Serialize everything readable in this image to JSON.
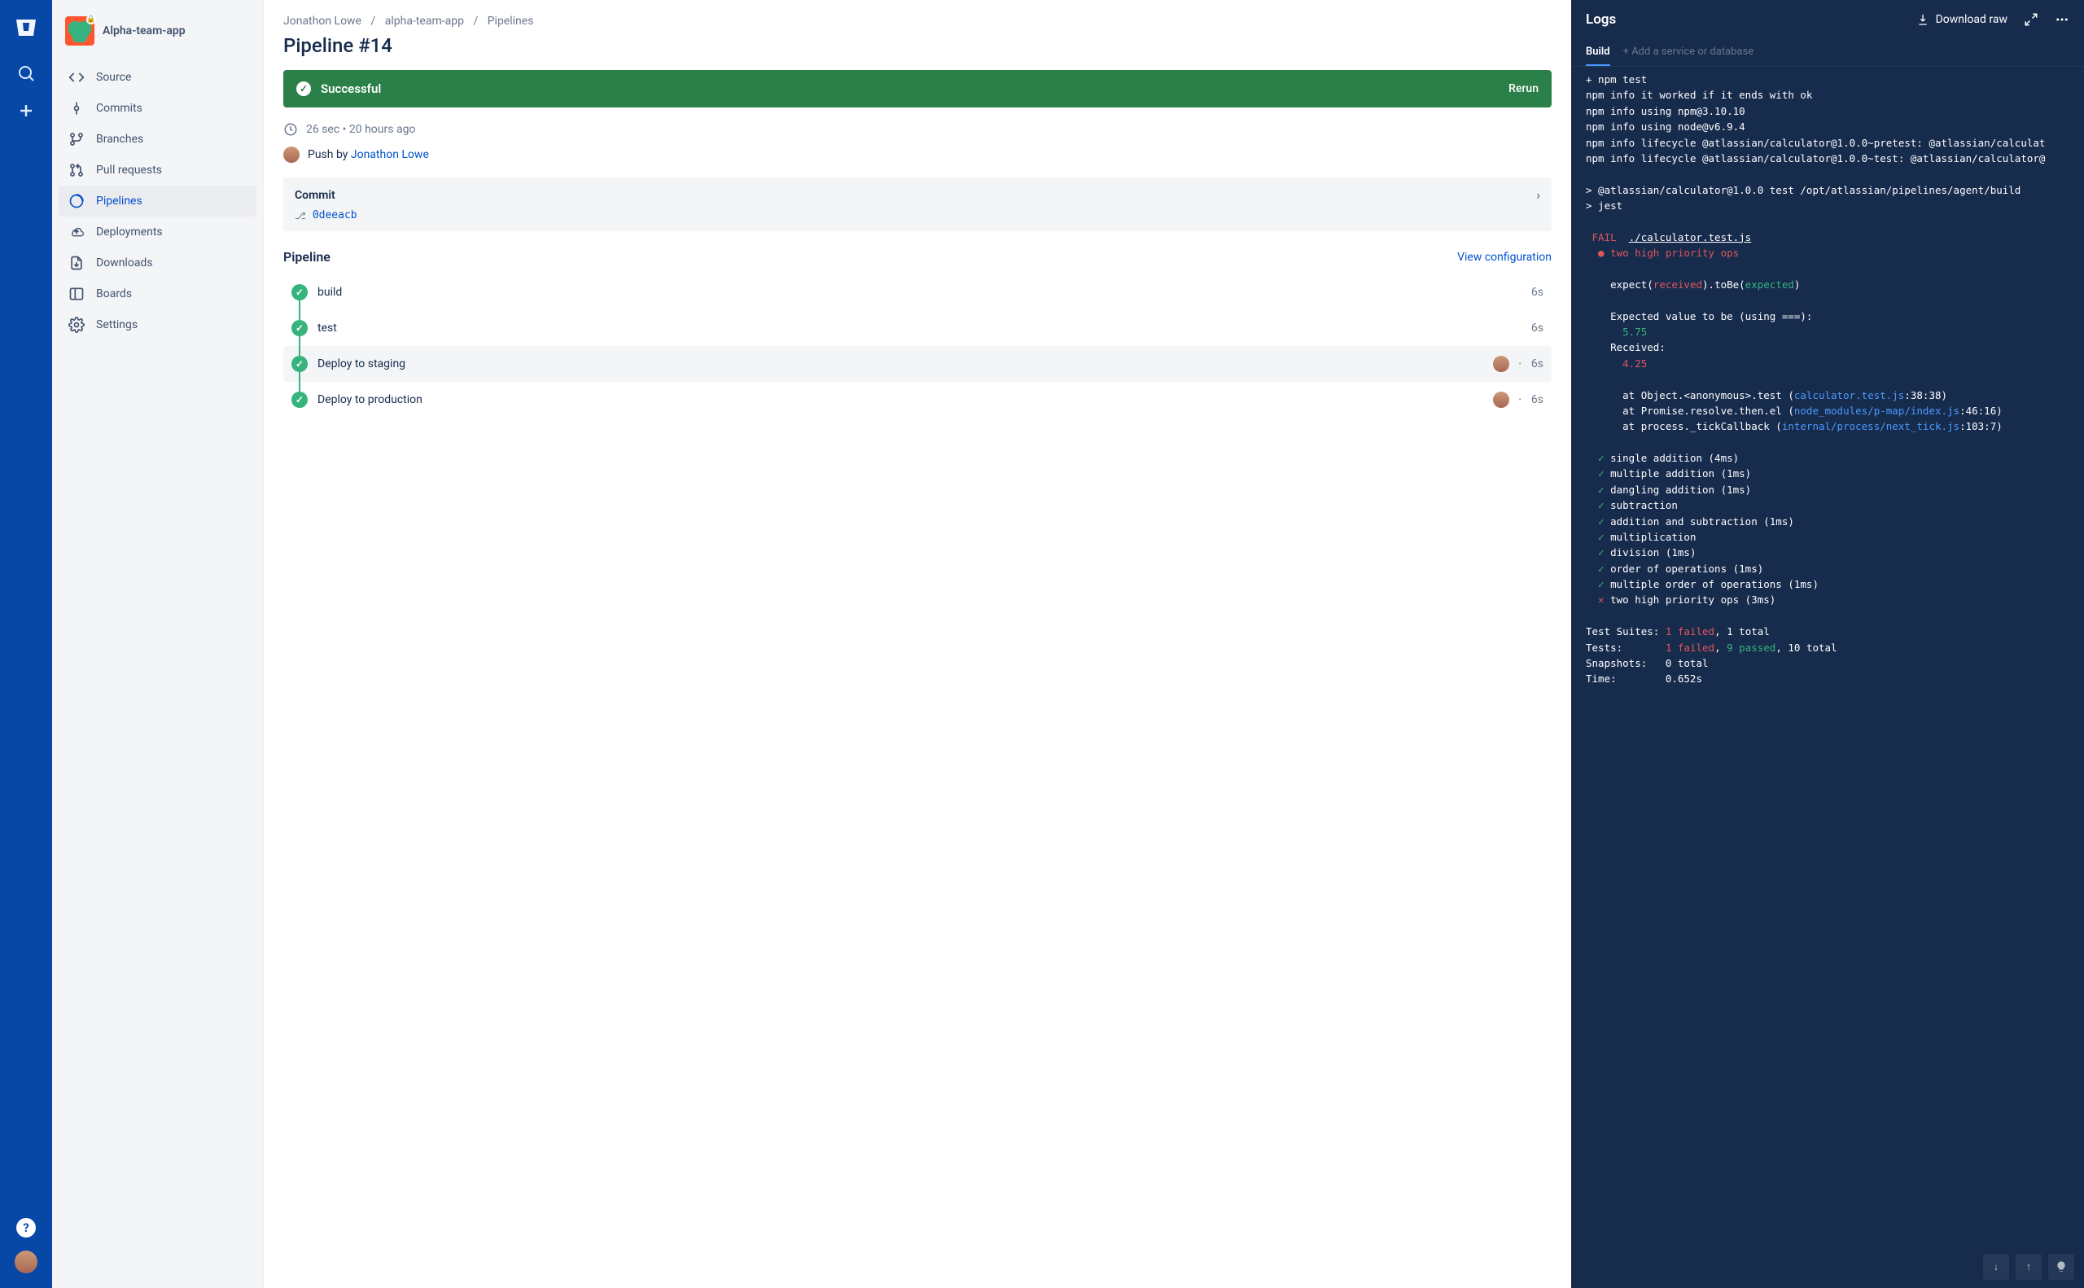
{
  "globalRail": {
    "help_label": "?",
    "search_name": "search-icon",
    "add_name": "plus-icon"
  },
  "repo": {
    "name": "Alpha-team-app",
    "nav": [
      {
        "icon": "code",
        "label": "Source"
      },
      {
        "icon": "commit",
        "label": "Commits"
      },
      {
        "icon": "branch",
        "label": "Branches"
      },
      {
        "icon": "pr",
        "label": "Pull requests"
      },
      {
        "icon": "pipeline",
        "label": "Pipelines",
        "active": true
      },
      {
        "icon": "deploy",
        "label": "Deployments"
      },
      {
        "icon": "download",
        "label": "Downloads"
      },
      {
        "icon": "board",
        "label": "Boards"
      },
      {
        "icon": "settings",
        "label": "Settings"
      }
    ]
  },
  "breadcrumb": {
    "owner": "Jonathon Lowe",
    "repo": "alpha-team-app",
    "section": "Pipelines"
  },
  "page_title": "Pipeline #14",
  "status": {
    "label": "Successful",
    "rerun_label": "Rerun"
  },
  "meta": {
    "duration": "26 sec",
    "sep": "•",
    "when": "20 hours ago",
    "push_prefix": "Push by",
    "pusher": "Jonathon Lowe"
  },
  "commit": {
    "heading": "Commit",
    "hash": "0deeacb"
  },
  "pipeline_section": {
    "heading": "Pipeline",
    "config_link": "View configuration",
    "steps": [
      {
        "name": "build",
        "time": "6s",
        "has_avatar": false,
        "selected": false
      },
      {
        "name": "test",
        "time": "6s",
        "has_avatar": false,
        "selected": false
      },
      {
        "name": "Deploy to staging",
        "time": "6s",
        "has_avatar": true,
        "selected": true
      },
      {
        "name": "Deploy to production",
        "time": "6s",
        "has_avatar": true,
        "selected": false
      }
    ]
  },
  "logs": {
    "title": "Logs",
    "download_label": "Download raw",
    "tab_build": "Build",
    "tab_add": "+ Add a service or database",
    "lines": [
      {
        "segs": [
          {
            "t": "+ npm test",
            "c": "c-white"
          }
        ]
      },
      {
        "segs": [
          {
            "t": "npm ",
            "c": "c-white"
          },
          {
            "t": "info",
            "c": "c-white"
          },
          {
            "t": " it worked if it ends with ok",
            "c": "c-white"
          }
        ]
      },
      {
        "segs": [
          {
            "t": "npm ",
            "c": "c-white"
          },
          {
            "t": "info",
            "c": "c-white"
          },
          {
            "t": " using npm@3.10.10",
            "c": "c-white"
          }
        ]
      },
      {
        "segs": [
          {
            "t": "npm ",
            "c": "c-white"
          },
          {
            "t": "info",
            "c": "c-white"
          },
          {
            "t": " using node@v6.9.4",
            "c": "c-white"
          }
        ]
      },
      {
        "segs": [
          {
            "t": "npm ",
            "c": "c-white"
          },
          {
            "t": "info lifecycle @atlassian/calculator@1.0.0~pretest: @atlassian/calculat",
            "c": "c-white"
          }
        ]
      },
      {
        "segs": [
          {
            "t": "npm ",
            "c": "c-white"
          },
          {
            "t": "info lifecycle @atlassian/calculator@1.0.0~test: @atlassian/calculator@",
            "c": "c-white"
          }
        ]
      },
      {
        "segs": [
          {
            "t": "",
            "c": ""
          }
        ]
      },
      {
        "segs": [
          {
            "t": "> @atlassian/calculator@1.0.0 test /opt/atlassian/pipelines/agent/build",
            "c": "c-white"
          }
        ]
      },
      {
        "segs": [
          {
            "t": "> jest",
            "c": "c-white"
          }
        ]
      },
      {
        "segs": [
          {
            "t": "",
            "c": ""
          }
        ]
      },
      {
        "segs": [
          {
            "t": " FAIL ",
            "c": "c-red"
          },
          {
            "t": " ",
            "c": ""
          },
          {
            "t": "./calculator.test.js",
            "c": "c-white u"
          }
        ]
      },
      {
        "segs": [
          {
            "t": "  ● ",
            "c": "bullet-red"
          },
          {
            "t": "two high priority ops",
            "c": "c-red"
          }
        ]
      },
      {
        "segs": [
          {
            "t": "",
            "c": ""
          }
        ]
      },
      {
        "segs": [
          {
            "t": "    expect(",
            "c": "c-white"
          },
          {
            "t": "received",
            "c": "c-red"
          },
          {
            "t": ").toBe(",
            "c": "c-white"
          },
          {
            "t": "expected",
            "c": "c-green"
          },
          {
            "t": ")",
            "c": "c-white"
          }
        ]
      },
      {
        "segs": [
          {
            "t": "",
            "c": ""
          }
        ]
      },
      {
        "segs": [
          {
            "t": "    Expected value to be (using ===):",
            "c": "c-white"
          }
        ]
      },
      {
        "segs": [
          {
            "t": "      5.75",
            "c": "c-green"
          }
        ]
      },
      {
        "segs": [
          {
            "t": "    Received:",
            "c": "c-white"
          }
        ]
      },
      {
        "segs": [
          {
            "t": "      4.25",
            "c": "c-red"
          }
        ]
      },
      {
        "segs": [
          {
            "t": "",
            "c": ""
          }
        ]
      },
      {
        "segs": [
          {
            "t": "      at Object.<anonymous>.test (",
            "c": "c-white"
          },
          {
            "t": "calculator.test.js",
            "c": "c-cyan"
          },
          {
            "t": ":38:38)",
            "c": "c-white"
          }
        ]
      },
      {
        "segs": [
          {
            "t": "      at Promise.resolve.then.el (",
            "c": "c-white"
          },
          {
            "t": "node_modules/p-map/index.js",
            "c": "c-cyan"
          },
          {
            "t": ":46:16)",
            "c": "c-white"
          }
        ]
      },
      {
        "segs": [
          {
            "t": "      at process._tickCallback (",
            "c": "c-white"
          },
          {
            "t": "internal/process/next_tick.js",
            "c": "c-cyan"
          },
          {
            "t": ":103:7)",
            "c": "c-white"
          }
        ]
      },
      {
        "segs": [
          {
            "t": "",
            "c": ""
          }
        ]
      },
      {
        "segs": [
          {
            "t": "  ✓ ",
            "c": "c-green"
          },
          {
            "t": "single addition (4ms)",
            "c": "c-white"
          }
        ]
      },
      {
        "segs": [
          {
            "t": "  ✓ ",
            "c": "c-green"
          },
          {
            "t": "multiple addition (1ms)",
            "c": "c-white"
          }
        ]
      },
      {
        "segs": [
          {
            "t": "  ✓ ",
            "c": "c-green"
          },
          {
            "t": "dangling addition (1ms)",
            "c": "c-white"
          }
        ]
      },
      {
        "segs": [
          {
            "t": "  ✓ ",
            "c": "c-green"
          },
          {
            "t": "subtraction",
            "c": "c-white"
          }
        ]
      },
      {
        "segs": [
          {
            "t": "  ✓ ",
            "c": "c-green"
          },
          {
            "t": "addition and subtraction (1ms)",
            "c": "c-white"
          }
        ]
      },
      {
        "segs": [
          {
            "t": "  ✓ ",
            "c": "c-green"
          },
          {
            "t": "multiplication",
            "c": "c-white"
          }
        ]
      },
      {
        "segs": [
          {
            "t": "  ✓ ",
            "c": "c-green"
          },
          {
            "t": "division (1ms)",
            "c": "c-white"
          }
        ]
      },
      {
        "segs": [
          {
            "t": "  ✓ ",
            "c": "c-green"
          },
          {
            "t": "order of operations (1ms)",
            "c": "c-white"
          }
        ]
      },
      {
        "segs": [
          {
            "t": "  ✓ ",
            "c": "c-green"
          },
          {
            "t": "multiple order of operations (1ms)",
            "c": "c-white"
          }
        ]
      },
      {
        "segs": [
          {
            "t": "  ✕ ",
            "c": "c-red"
          },
          {
            "t": "two high priority ops (3ms)",
            "c": "c-white"
          }
        ]
      },
      {
        "segs": [
          {
            "t": "",
            "c": ""
          }
        ]
      },
      {
        "segs": [
          {
            "t": "Test Suites: ",
            "c": "c-white"
          },
          {
            "t": "1 failed",
            "c": "c-red"
          },
          {
            "t": ", 1 total",
            "c": "c-white"
          }
        ]
      },
      {
        "segs": [
          {
            "t": "Tests:       ",
            "c": "c-white"
          },
          {
            "t": "1 failed",
            "c": "c-red"
          },
          {
            "t": ", ",
            "c": "c-white"
          },
          {
            "t": "9 passed",
            "c": "c-green"
          },
          {
            "t": ", 10 total",
            "c": "c-white"
          }
        ]
      },
      {
        "segs": [
          {
            "t": "Snapshots:   0 total",
            "c": "c-white"
          }
        ]
      },
      {
        "segs": [
          {
            "t": "Time:        0.652s",
            "c": "c-white"
          }
        ]
      }
    ]
  }
}
